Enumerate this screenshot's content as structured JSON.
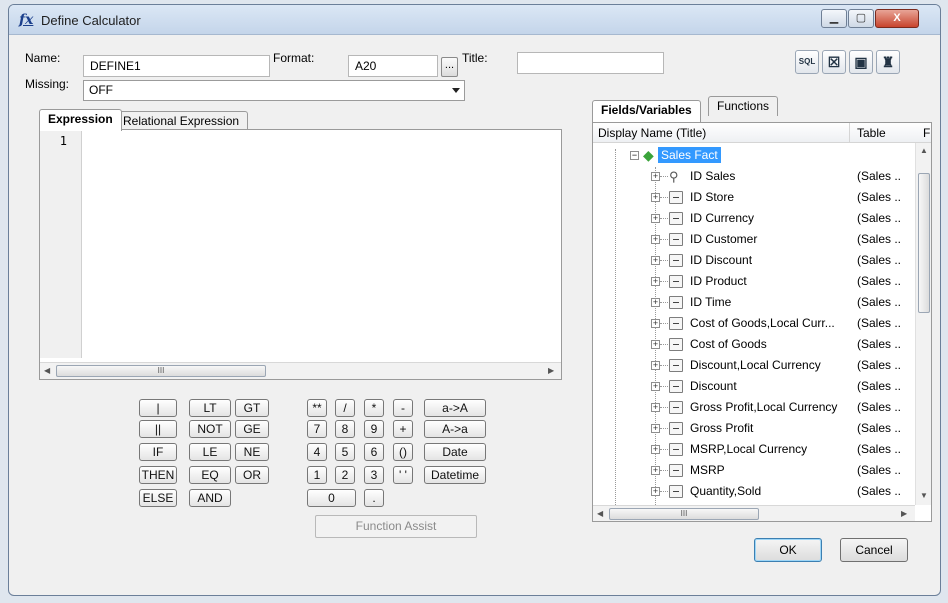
{
  "window": {
    "title": "Define Calculator",
    "minimize": "▁",
    "maximize": "▢",
    "close": "X"
  },
  "form": {
    "name_label": "Name:",
    "name_value": "DEFINE1",
    "format_label": "Format:",
    "format_value": "A20",
    "format_browse": "...",
    "title_label": "Title:",
    "title_value": "",
    "missing_label": "Missing:",
    "missing_value": "OFF"
  },
  "toolbar": {
    "sql": "SQL",
    "check": "☒",
    "paste": "▣",
    "find": "♜"
  },
  "expression_tabs": [
    "Expression",
    "Relational Expression"
  ],
  "editor": {
    "line_number": "1",
    "scroll_thumb": "III"
  },
  "keypad": {
    "operators_col1": [
      "|",
      "||",
      "IF",
      "THEN",
      "ELSE"
    ],
    "operators_col2": [
      "LT",
      "NOT",
      "LE",
      "EQ",
      "AND"
    ],
    "operators_col3": [
      "GT",
      "GE",
      "NE",
      "OR"
    ],
    "math_row1": [
      "**",
      "/",
      "*",
      "-",
      "a->A"
    ],
    "math_row2": [
      "7",
      "8",
      "9",
      "+",
      "A->a"
    ],
    "math_row3": [
      "4",
      "5",
      "6",
      "()",
      "Date"
    ],
    "math_row4": [
      "1",
      "2",
      "3",
      "' '",
      "Datetime"
    ],
    "math_row5": [
      "0",
      "."
    ],
    "function_assist": "Function Assist"
  },
  "field_tabs": [
    "Fields/Variables",
    "Functions"
  ],
  "tree": {
    "col_display": "Display Name (Title)",
    "col_table": "Table",
    "col_extra": "F",
    "root": "Sales Fact",
    "items": [
      {
        "name": "ID Sales",
        "table": "(Sales ..",
        "key": true
      },
      {
        "name": "ID Store",
        "table": "(Sales .."
      },
      {
        "name": "ID Currency",
        "table": "(Sales .."
      },
      {
        "name": "ID Customer",
        "table": "(Sales .."
      },
      {
        "name": "ID Discount",
        "table": "(Sales .."
      },
      {
        "name": "ID Product",
        "table": "(Sales .."
      },
      {
        "name": "ID Time",
        "table": "(Sales .."
      },
      {
        "name": "Cost of Goods,Local Curr...",
        "table": "(Sales .."
      },
      {
        "name": "Cost of Goods",
        "table": "(Sales .."
      },
      {
        "name": "Discount,Local Currency",
        "table": "(Sales .."
      },
      {
        "name": "Discount",
        "table": "(Sales .."
      },
      {
        "name": "Gross Profit,Local Currency",
        "table": "(Sales .."
      },
      {
        "name": "Gross Profit",
        "table": "(Sales .."
      },
      {
        "name": "MSRP,Local Currency",
        "table": "(Sales .."
      },
      {
        "name": "MSRP",
        "table": "(Sales .."
      },
      {
        "name": "Quantity,Sold",
        "table": "(Sales .."
      }
    ],
    "scroll_thumb": "III"
  },
  "buttons": {
    "ok": "OK",
    "cancel": "Cancel"
  }
}
